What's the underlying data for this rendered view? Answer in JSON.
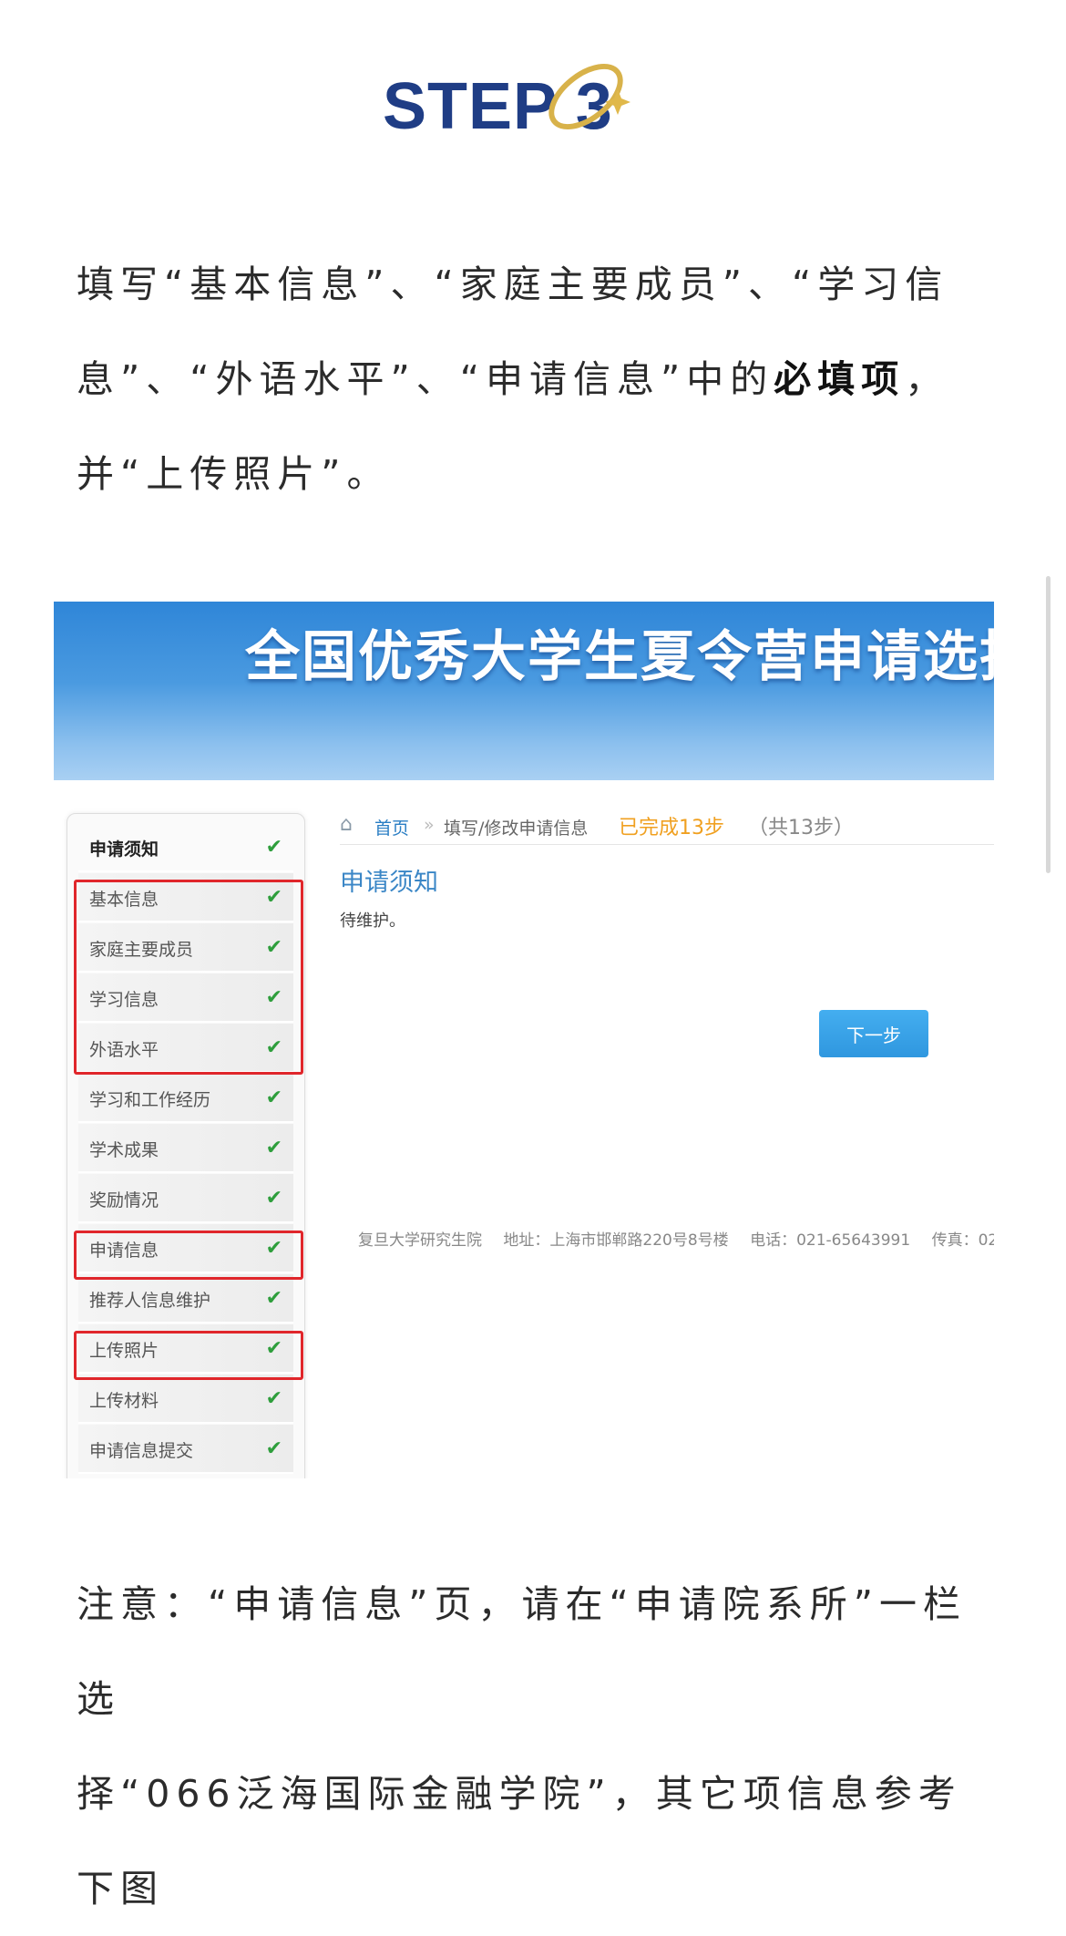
{
  "heading": {
    "step": "STEP 3"
  },
  "intro": {
    "part1": "填写“基本信息”、“家庭主要成员”、“学习信息”、“外语水平”、“申请信息”中的",
    "bold": "必填项",
    "part2": "，并“上传照片”。"
  },
  "screenshot": {
    "banner_title": "全国优秀大学生夏令营申请选择",
    "breadcrumb": {
      "home": "首页",
      "separator": "»",
      "current": "填写/修改申请信息",
      "progress": "已完成13步",
      "total": "（共13步）"
    },
    "section_title": "申请须知",
    "section_body": "待维护。",
    "next_label": "下一步",
    "sidebar": [
      {
        "label": "申请须知",
        "check": "✔"
      },
      {
        "label": "基本信息",
        "check": "✔"
      },
      {
        "label": "家庭主要成员",
        "check": "✔"
      },
      {
        "label": "学习信息",
        "check": "✔"
      },
      {
        "label": "外语水平",
        "check": "✔"
      },
      {
        "label": "学习和工作经历",
        "check": "✔"
      },
      {
        "label": "学术成果",
        "check": "✔"
      },
      {
        "label": "奖励情况",
        "check": "✔"
      },
      {
        "label": "申请信息",
        "check": "✔"
      },
      {
        "label": "推荐人信息维护",
        "check": "✔"
      },
      {
        "label": "上传照片",
        "check": "✔"
      },
      {
        "label": "上传材料",
        "check": "✔"
      },
      {
        "label": "申请信息提交",
        "check": "✔"
      }
    ],
    "footer": {
      "org": "复旦大学研究生院",
      "address": "地址：上海市邯郸路220号8号楼",
      "phone": "电话：021-65643991",
      "fax": "传真：02"
    }
  },
  "note": {
    "line1": "注意：“申请信息”页，请在“申请院系所”一栏选",
    "line2": "择“066泛海国际金融学院”，其它项信息参考下图"
  },
  "colors": {
    "heading": "#1f3d85",
    "gold": "#d8b24a",
    "highlight": "#e0262b",
    "check": "#2e9e3c",
    "link": "#2a7ec4"
  }
}
